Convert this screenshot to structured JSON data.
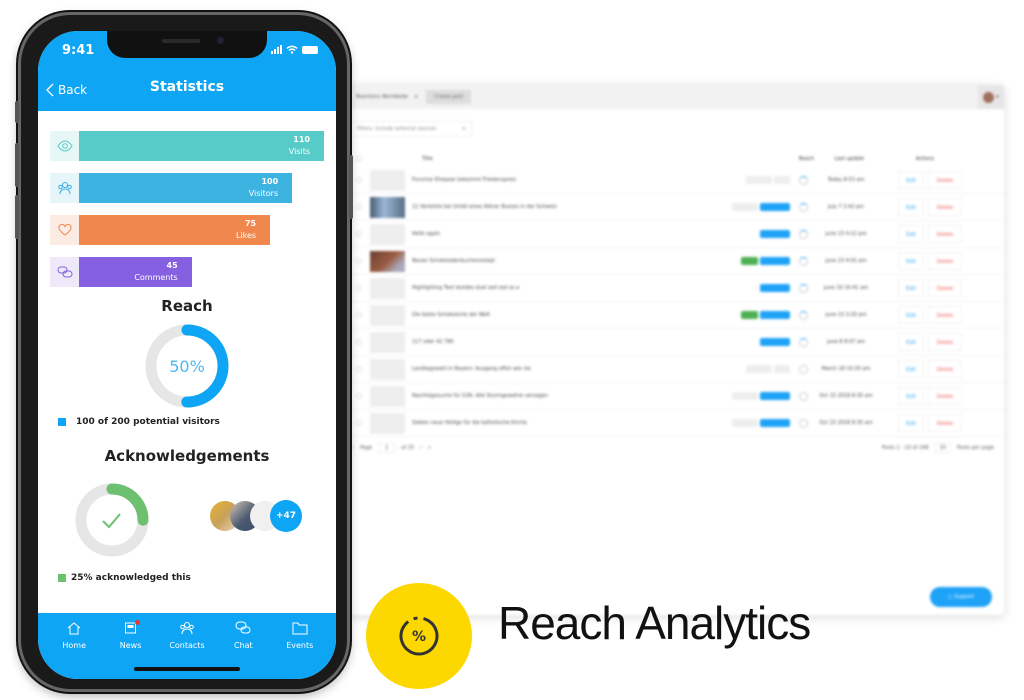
{
  "phone": {
    "status_bar": {
      "time": "9:41"
    },
    "nav": {
      "back_label": "Back",
      "title": "Statistics"
    },
    "stats": [
      {
        "value": "110",
        "label": "Visits",
        "icon": "eye-icon",
        "color": "#56cbc8",
        "bg": "#e6f7f6",
        "fraction": 1.0
      },
      {
        "value": "100",
        "label": "Visitors",
        "icon": "people-icon",
        "color": "#3db3e2",
        "bg": "#e5f5fa",
        "fraction": 0.87
      },
      {
        "value": "75",
        "label": "Likes",
        "icon": "heart-icon",
        "color": "#f0874c",
        "bg": "#fcebe3",
        "fraction": 0.78
      },
      {
        "value": "45",
        "label": "Comments",
        "icon": "chat-bubbles-icon",
        "color": "#8560e0",
        "bg": "#eee9f9",
        "fraction": 0.46
      }
    ],
    "reach": {
      "title": "Reach",
      "percent_label": "50%",
      "percent": 50,
      "legend": "100 of 200 potential visitors",
      "color": "#0ea5f5"
    },
    "acknowledgements": {
      "title": "Acknowledgements",
      "percent": 25,
      "legend": "25% acknowledged this",
      "more_count": "+47",
      "color": "#6cc070"
    },
    "tabbar": [
      {
        "label": "Home",
        "icon": "home-icon"
      },
      {
        "label": "News",
        "icon": "news-icon",
        "badge": true
      },
      {
        "label": "Contacts",
        "icon": "contacts-icon"
      },
      {
        "label": "Chat",
        "icon": "chat-icon"
      },
      {
        "label": "Events",
        "icon": "folder-icon"
      }
    ]
  },
  "dashboard": {
    "tab_label": "Reactions Worldwide",
    "create_label": "Create post",
    "filter_label": "Filters: include external sources",
    "columns": {
      "title": "Title",
      "reach": "Reach",
      "last_update": "Last update",
      "actions": "Actions"
    },
    "rows": [
      {
        "title": "Forscher Ehepaar bekommt Friedenspreis",
        "updated": "Today 8:53 am",
        "thumb": "none",
        "tags": [
          "grey",
          "grey2"
        ],
        "reach": "part"
      },
      {
        "title": "12 Verletzte bei Unfall eines Kölner Busses in der Schweiz",
        "updated": "july 7 2:42 pm",
        "thumb": "img1",
        "tags": [
          "grey",
          "blue"
        ],
        "reach": "part"
      },
      {
        "title": "Hello again",
        "updated": "june 23 4:12 pm",
        "thumb": "none",
        "tags": [
          "blue"
        ],
        "reach": "part"
      },
      {
        "title": "Neues Schokoladenkuchenrezept",
        "updated": "june 23 4:01 pm",
        "thumb": "img2",
        "tags": [
          "green",
          "blue"
        ],
        "reach": "part"
      },
      {
        "title": "Highlighting Text testdes duel sed sed as a",
        "updated": "june 19 10:41 am",
        "thumb": "none",
        "tags": [
          "blue"
        ],
        "reach": "part"
      },
      {
        "title": "Die beste Schokotorte der Welt",
        "updated": "june 15 3:20 pm",
        "thumb": "none",
        "tags": [
          "green",
          "blue"
        ],
        "reach": "part"
      },
      {
        "title": "117 oder 42 780",
        "updated": "june 8 8:47 am",
        "thumb": "none",
        "tags": [
          "blue"
        ],
        "reach": "part"
      },
      {
        "title": "Landtagswahl in Bayern: Ausgang offen wie nie",
        "updated": "March 18 10:20 am",
        "thumb": "none",
        "tags": [
          "grey",
          "grey2"
        ],
        "reach": "none"
      },
      {
        "title": "Nachfolgesuche für G36: Alle Sturmgewehre versagen",
        "updated": "Oct 15 2018 8:35 am",
        "thumb": "none",
        "tags": [
          "grey",
          "blue"
        ],
        "reach": "none"
      },
      {
        "title": "Sieben neue Heilige für die katholische Kirche",
        "updated": "Oct 15 2018 8:35 am",
        "thumb": "none",
        "tags": [
          "grey",
          "blue"
        ],
        "reach": "none"
      }
    ],
    "edit_label": "Edit",
    "delete_label": "Delete",
    "pager": {
      "page_label": "Page",
      "page": "1",
      "of_label": "of 25"
    },
    "posts_info": "Posts 1 - 10 of 248",
    "per_page": "10",
    "per_page_label": "Posts per page",
    "support_label": "Support"
  },
  "brand": {
    "title": "Reach Analytics",
    "badge_symbol": "%",
    "badge_color": "#fcd800"
  }
}
